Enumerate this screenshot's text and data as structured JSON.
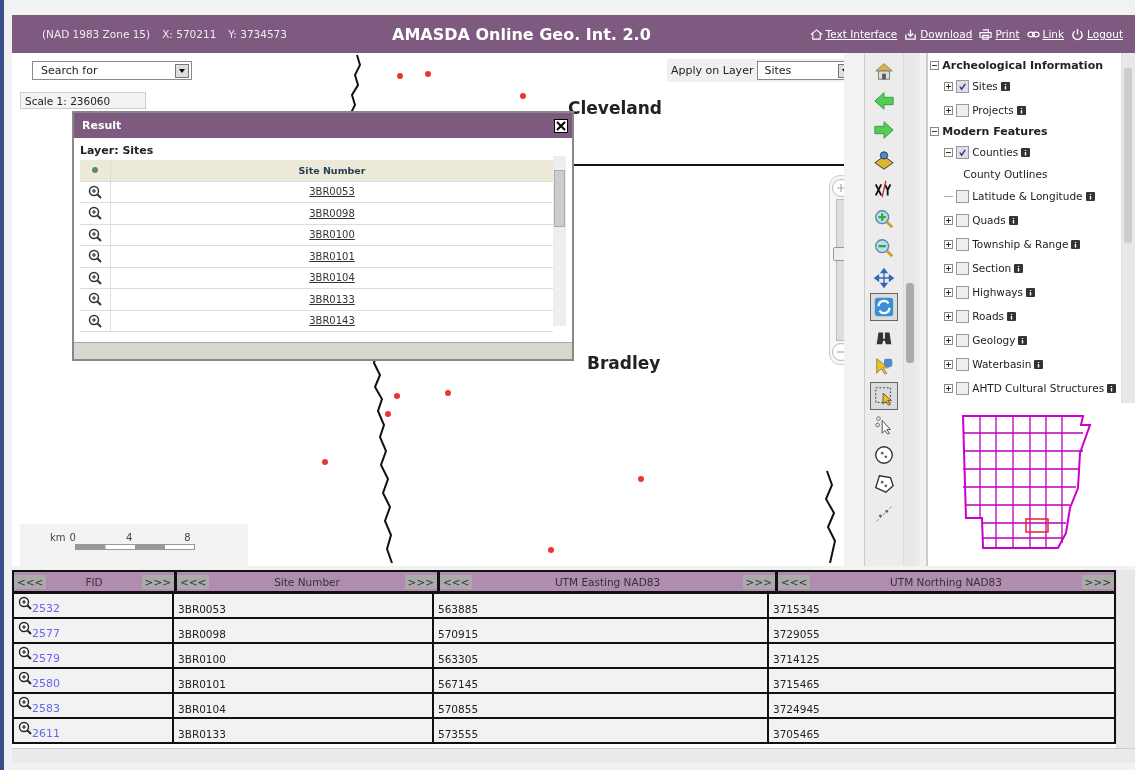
{
  "header": {
    "zone": "(NAD 1983 Zone 15)",
    "x": "X: 570211",
    "y": "Y: 3734573",
    "title": "AMASDA Online Geo. Int. 2.0",
    "links": [
      {
        "kind": "text",
        "label": "Text Interface"
      },
      {
        "kind": "download",
        "label": "Download"
      },
      {
        "kind": "print",
        "label": "Print"
      },
      {
        "kind": "link",
        "label": "Link"
      },
      {
        "kind": "logout",
        "label": "Logout"
      }
    ]
  },
  "map": {
    "search": {
      "value": "Search for"
    },
    "apply_label": "Apply on Layer",
    "apply_layer": {
      "value": "Sites"
    },
    "scale_label": "Scale 1:",
    "scale_value": "236060",
    "places": [
      "Cleveland",
      "Bradley"
    ],
    "zoom_slider": {
      "level": 0.62
    },
    "scale_bar": {
      "unit": "km",
      "ticks": [
        "0",
        "4",
        "8"
      ]
    }
  },
  "result": {
    "title": "Result",
    "layer": "Layer: Sites",
    "column": "Site Number",
    "rows": [
      "3BR0053",
      "3BR0098",
      "3BR0100",
      "3BR0101",
      "3BR0104",
      "3BR0133",
      "3BR0143"
    ]
  },
  "tools": [
    {
      "kind": "home",
      "selected": false
    },
    {
      "kind": "back",
      "selected": false
    },
    {
      "kind": "forward",
      "selected": false
    },
    {
      "kind": "locate",
      "selected": false
    },
    {
      "kind": "xy",
      "selected": false
    },
    {
      "kind": "zoom-in",
      "selected": false
    },
    {
      "kind": "zoom-out",
      "selected": false
    },
    {
      "kind": "pan",
      "selected": false
    },
    {
      "kind": "refresh",
      "selected": true
    },
    {
      "kind": "binoculars",
      "selected": false
    },
    {
      "kind": "identify",
      "selected": false
    },
    {
      "kind": "select-box",
      "selected": true
    },
    {
      "kind": "select-point",
      "selected": false
    },
    {
      "kind": "select-circle",
      "selected": false
    },
    {
      "kind": "select-polygon",
      "selected": false
    },
    {
      "kind": "select-line",
      "selected": false
    }
  ],
  "layers": [
    {
      "kind": "group",
      "label": "Archeological Information",
      "expanded": true,
      "children": [
        {
          "kind": "layer",
          "label": "Sites",
          "expanded": false,
          "checked": true
        },
        {
          "kind": "layer",
          "label": "Projects",
          "expanded": false,
          "checked": false
        }
      ]
    },
    {
      "kind": "group",
      "label": "Modern Features",
      "expanded": true,
      "children": [
        {
          "kind": "layer",
          "label": "Counties",
          "expanded": true,
          "checked": true,
          "children": [
            {
              "kind": "legend",
              "label": "County Outlines"
            }
          ]
        },
        {
          "kind": "leaf",
          "label": "Latitude & Longitude",
          "checked": false
        },
        {
          "kind": "layer",
          "label": "Quads",
          "expanded": false,
          "checked": false
        },
        {
          "kind": "layer",
          "label": "Township & Range",
          "expanded": false,
          "checked": false
        },
        {
          "kind": "layer",
          "label": "Section",
          "expanded": false,
          "checked": false
        },
        {
          "kind": "layer",
          "label": "Highways",
          "expanded": false,
          "checked": false
        },
        {
          "kind": "layer",
          "label": "Roads",
          "expanded": false,
          "checked": false
        },
        {
          "kind": "layer",
          "label": "Geology",
          "expanded": false,
          "checked": false
        },
        {
          "kind": "layer",
          "label": "Waterbasin",
          "expanded": false,
          "checked": false
        },
        {
          "kind": "layer",
          "label": "AHTD Cultural Structures",
          "expanded": false,
          "checked": false
        }
      ]
    }
  ],
  "table": {
    "columns": [
      {
        "label": "FID",
        "prev": "<<<",
        "next": ">>>"
      },
      {
        "label": "Site Number",
        "prev": "<<<",
        "next": ">>>"
      },
      {
        "label": "UTM Easting NAD83",
        "prev": "<<<",
        "next": ">>>"
      },
      {
        "label": "UTM Northing NAD83",
        "prev": "<<<",
        "next": ">>>"
      }
    ],
    "rows": [
      {
        "fid": "2532",
        "site": "3BR0053",
        "easting": "563885",
        "northing": "3715345"
      },
      {
        "fid": "2577",
        "site": "3BR0098",
        "easting": "570915",
        "northing": "3729055"
      },
      {
        "fid": "2579",
        "site": "3BR0100",
        "easting": "563305",
        "northing": "3714125"
      },
      {
        "fid": "2580",
        "site": "3BR0101",
        "easting": "567145",
        "northing": "3715465"
      },
      {
        "fid": "2583",
        "site": "3BR0104",
        "easting": "570855",
        "northing": "3724945"
      },
      {
        "fid": "2611",
        "site": "3BR0133",
        "easting": "573555",
        "northing": "3705465"
      }
    ]
  }
}
